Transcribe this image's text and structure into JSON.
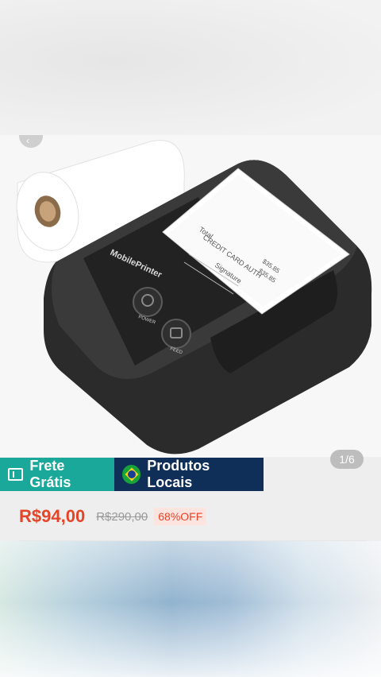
{
  "gallery": {
    "counter": "1/6",
    "printer_brand": "MobilePrinter",
    "power_label": "POWER",
    "feed_label": "FEED",
    "receipt_lines": [
      "Total",
      "CREDIT CARD AUTH",
      "Signature",
      "$35.85",
      "$35.85"
    ]
  },
  "badges": {
    "shipping": "Frete Grátis",
    "local": "Produtos Locais"
  },
  "price": {
    "current": "R$94,00",
    "original": "R$290,00",
    "discount": "68%OFF"
  },
  "colors": {
    "price": "#e54428",
    "shipping_badge": "#1aa89a",
    "local_badge": "#0f2f58"
  }
}
